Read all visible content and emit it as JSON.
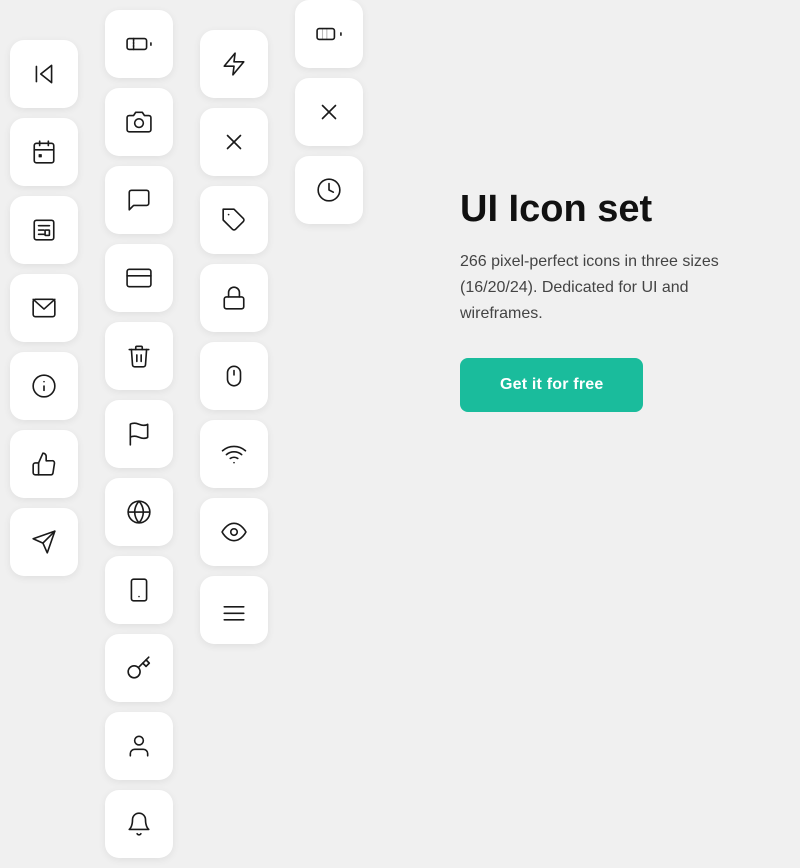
{
  "product": {
    "title": "UI Icon set",
    "description": "266 pixel-perfect icons in three sizes (16/20/24). Dedicated for UI and wireframes.",
    "cta_label": "Get it for free"
  },
  "colors": {
    "cta": "#1abc9c",
    "icon_stroke": "#1a1a1a",
    "background": "#f0f0f0",
    "card_bg": "#ffffff"
  }
}
